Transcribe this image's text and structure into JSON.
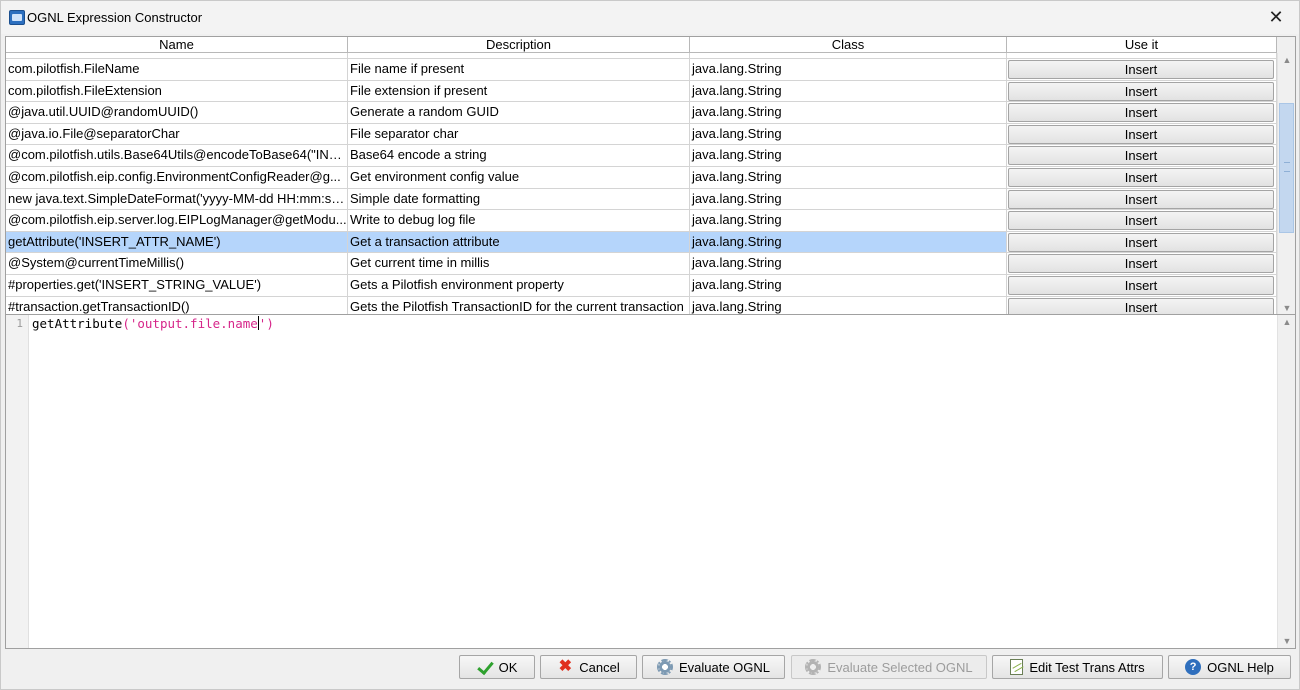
{
  "window": {
    "title": "OGNL Expression Constructor",
    "close_glyph": "✕"
  },
  "table": {
    "headers": {
      "name": "Name",
      "description": "Description",
      "class": "Class",
      "use_it": "Use it"
    },
    "rows": [
      {
        "name": "com.pilotfish.FileName",
        "description": "File name if present",
        "class": "java.lang.String",
        "action": "Insert"
      },
      {
        "name": "com.pilotfish.FileExtension",
        "description": "File extension if present",
        "class": "java.lang.String",
        "action": "Insert"
      },
      {
        "name": "@java.util.UUID@randomUUID()",
        "description": "Generate a random GUID",
        "class": "java.lang.String",
        "action": "Insert"
      },
      {
        "name": "@java.io.File@separatorChar",
        "description": "File separator char",
        "class": "java.lang.String",
        "action": "Insert"
      },
      {
        "name": "@com.pilotfish.utils.Base64Utils@encodeToBase64(\"INS...",
        "description": "Base64 encode a string",
        "class": "java.lang.String",
        "action": "Insert"
      },
      {
        "name": "@com.pilotfish.eip.config.EnvironmentConfigReader@g...",
        "description": "Get environment config value",
        "class": "java.lang.String",
        "action": "Insert"
      },
      {
        "name": "new java.text.SimpleDateFormat('yyyy-MM-dd HH:mm:ss...",
        "description": "Simple date formatting",
        "class": "java.lang.String",
        "action": "Insert"
      },
      {
        "name": "@com.pilotfish.eip.server.log.EIPLogManager@getModu...",
        "description": "Write to debug log file",
        "class": "java.lang.String",
        "action": "Insert"
      },
      {
        "name": "getAttribute('INSERT_ATTR_NAME')",
        "description": "Get a transaction attribute",
        "class": "java.lang.String",
        "action": "Insert",
        "selected": true
      },
      {
        "name": "@System@currentTimeMillis()",
        "description": "Get current time in millis",
        "class": "java.lang.String",
        "action": "Insert"
      },
      {
        "name": "#properties.get('INSERT_STRING_VALUE')",
        "description": "Gets a Pilotfish environment property",
        "class": "java.lang.String",
        "action": "Insert"
      },
      {
        "name": "#transaction.getTransactionID()",
        "description": "Gets the Pilotfish TransactionID for the current transaction",
        "class": "java.lang.String",
        "action": "Insert"
      }
    ],
    "scroll_up_glyph": "▲",
    "scroll_down_glyph": "▼"
  },
  "editor": {
    "line_number": "1",
    "code_fn": "getAttribute",
    "code_open": "(",
    "code_string": "'output.file.name",
    "code_string_end": "'",
    "code_close": ")"
  },
  "buttons": {
    "ok": "OK",
    "cancel": "Cancel",
    "evaluate": "Evaluate OGNL",
    "evaluate_selected": "Evaluate Selected OGNL",
    "edit_attrs": "Edit Test Trans Attrs",
    "help": "OGNL Help",
    "cancel_glyph": "✖",
    "help_glyph": "?"
  },
  "icons": [
    "app-icon",
    "close-icon",
    "check-icon",
    "cancel-icon",
    "gear-icon",
    "edit-icon",
    "help-icon"
  ]
}
